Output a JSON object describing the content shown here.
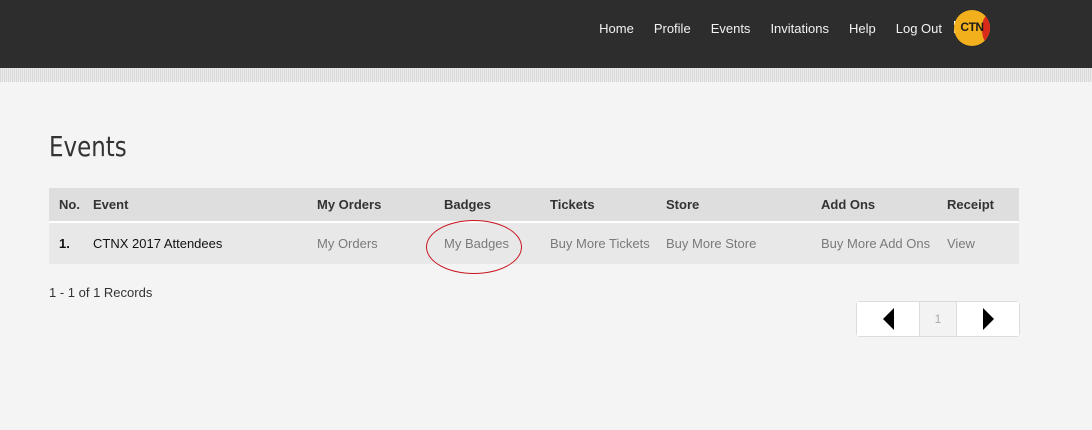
{
  "nav": {
    "items": [
      {
        "label": "Home"
      },
      {
        "label": "Profile"
      },
      {
        "label": "Events"
      },
      {
        "label": "Invitations"
      },
      {
        "label": "Help"
      },
      {
        "label": "Log Out"
      }
    ],
    "apps_icon": "grid-icon",
    "logo_text": "CTN"
  },
  "page": {
    "title": "Events"
  },
  "table": {
    "headers": [
      "No.",
      "Event",
      "My Orders",
      "Badges",
      "Tickets",
      "Store",
      "Add Ons",
      "Receipt"
    ],
    "rows": [
      {
        "no": "1.",
        "event": "CTNX 2017 Attendees",
        "my_orders": "My Orders",
        "badges": "My Badges",
        "tickets": "Buy More Tickets",
        "store": "Buy More Store",
        "add_ons": "Buy More Add Ons",
        "receipt": "View"
      }
    ]
  },
  "records_text": "1 - 1 of 1 Records",
  "pagination": {
    "current_page": "1",
    "prev_icon": "triangle-left-icon",
    "next_icon": "triangle-right-icon"
  },
  "colors": {
    "header_bg": "#2d2d2d",
    "highlight_circle": "#c8141e",
    "logo_yellow": "#f2b01c",
    "logo_red": "#d92a1c"
  }
}
